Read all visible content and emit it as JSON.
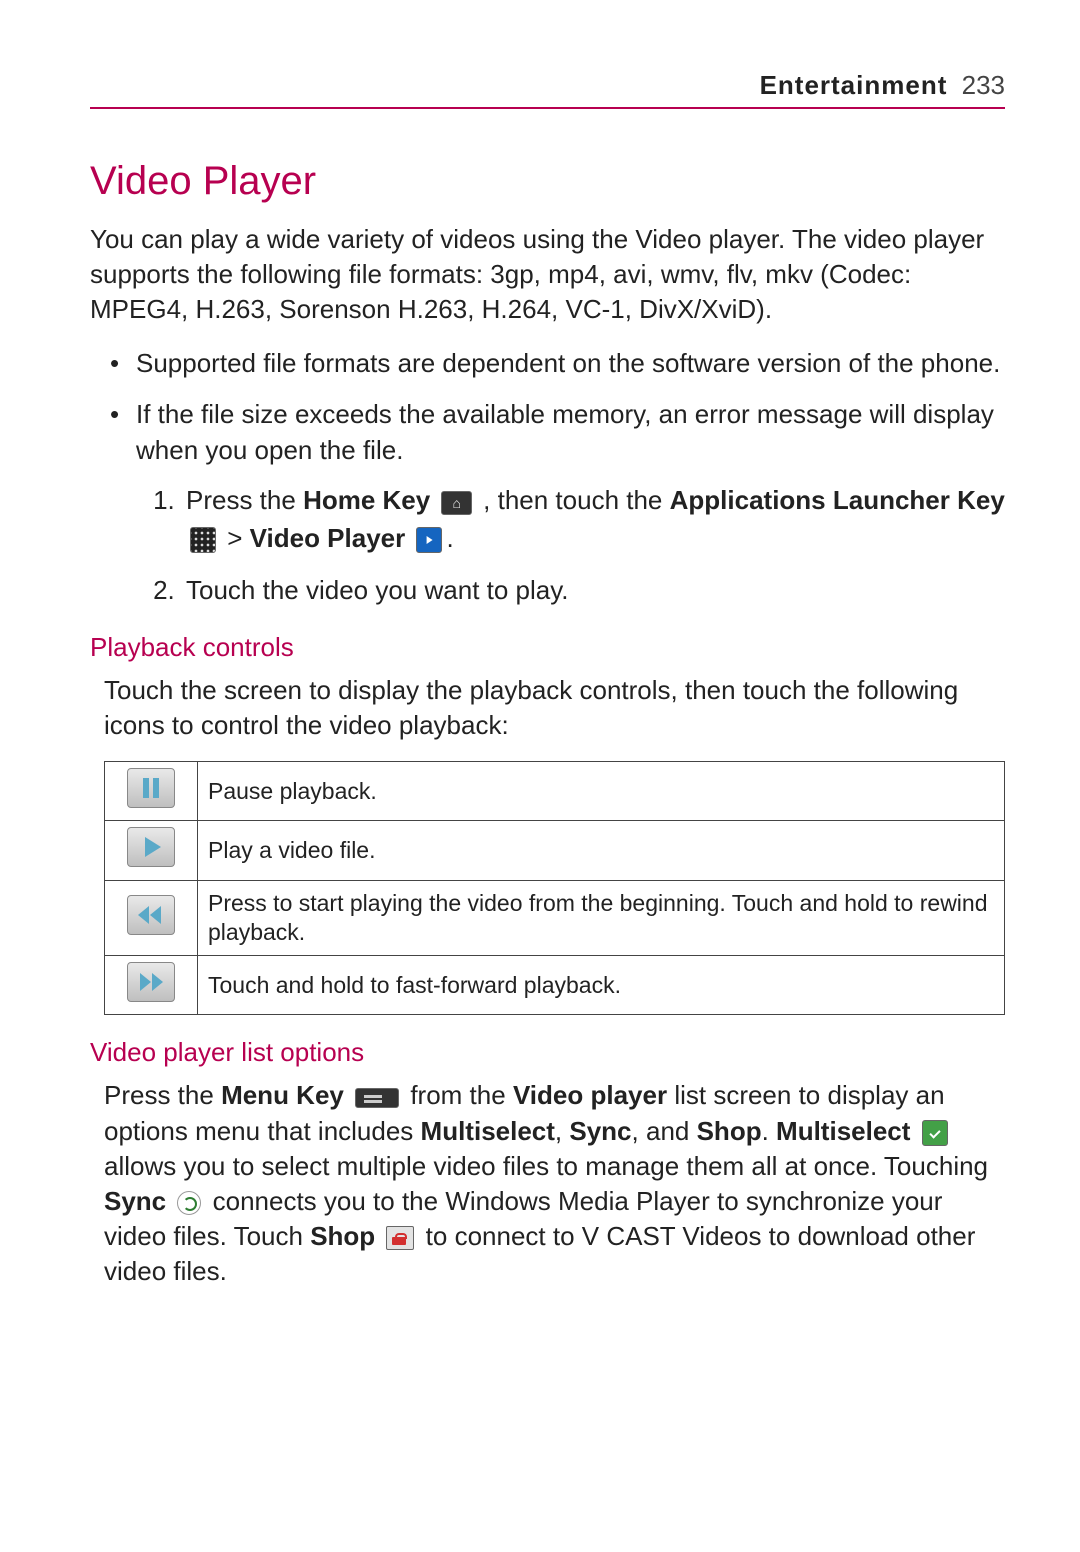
{
  "header": {
    "section": "Entertainment",
    "page": "233"
  },
  "title": "Video Player",
  "intro": "You can play a wide variety of videos using the Video player. The video player supports the following file formats: 3gp, mp4, avi, wmv, flv, mkv (Codec: MPEG4, H.263, Sorenson H.263, H.264, VC-1, DivX/XviD).",
  "bullets": [
    "Supported file formats are dependent on the software version of the phone.",
    "If the file size exceeds the available memory, an error message will display when you open the file."
  ],
  "steps": {
    "s1_a": "Press the ",
    "s1_home": "Home Key",
    "s1_b": " , then touch the ",
    "s1_apps": "Applications Launcher Key",
    "s1_gt": " > ",
    "s1_vp": "Video Player",
    "s1_end": ".",
    "s2": "Touch the video you want to play."
  },
  "sub1": "Playback controls",
  "sub1_para": "Touch the screen to display the playback controls, then touch the following icons to control the video playback:",
  "table": [
    {
      "icon": "pause",
      "desc": "Pause playback."
    },
    {
      "icon": "play",
      "desc": "Play a video file."
    },
    {
      "icon": "rewind",
      "desc": "Press to start playing the video from the beginning. Touch and hold to rewind playback."
    },
    {
      "icon": "forward",
      "desc": "Touch and hold to fast-forward playback."
    }
  ],
  "sub2": "Video player list options",
  "opts": {
    "a": "Press the ",
    "menu": "Menu Key",
    "b": " from the ",
    "vp": "Video player",
    "c": " list screen to display an options menu that includes ",
    "ms": "Multiselect",
    "comma": ", ",
    "sync": "Sync",
    "and": ", and ",
    "shop": "Shop",
    "d": ". ",
    "ms2": "Multiselect",
    "e": " allows you to select multiple video files to manage them all at once. Touching ",
    "sync2": "Sync",
    "f": " connects you to the Windows Media Player to synchronize your video files. Touch ",
    "shop2": "Shop",
    "g": " to connect to V CAST Videos to download other video files."
  }
}
